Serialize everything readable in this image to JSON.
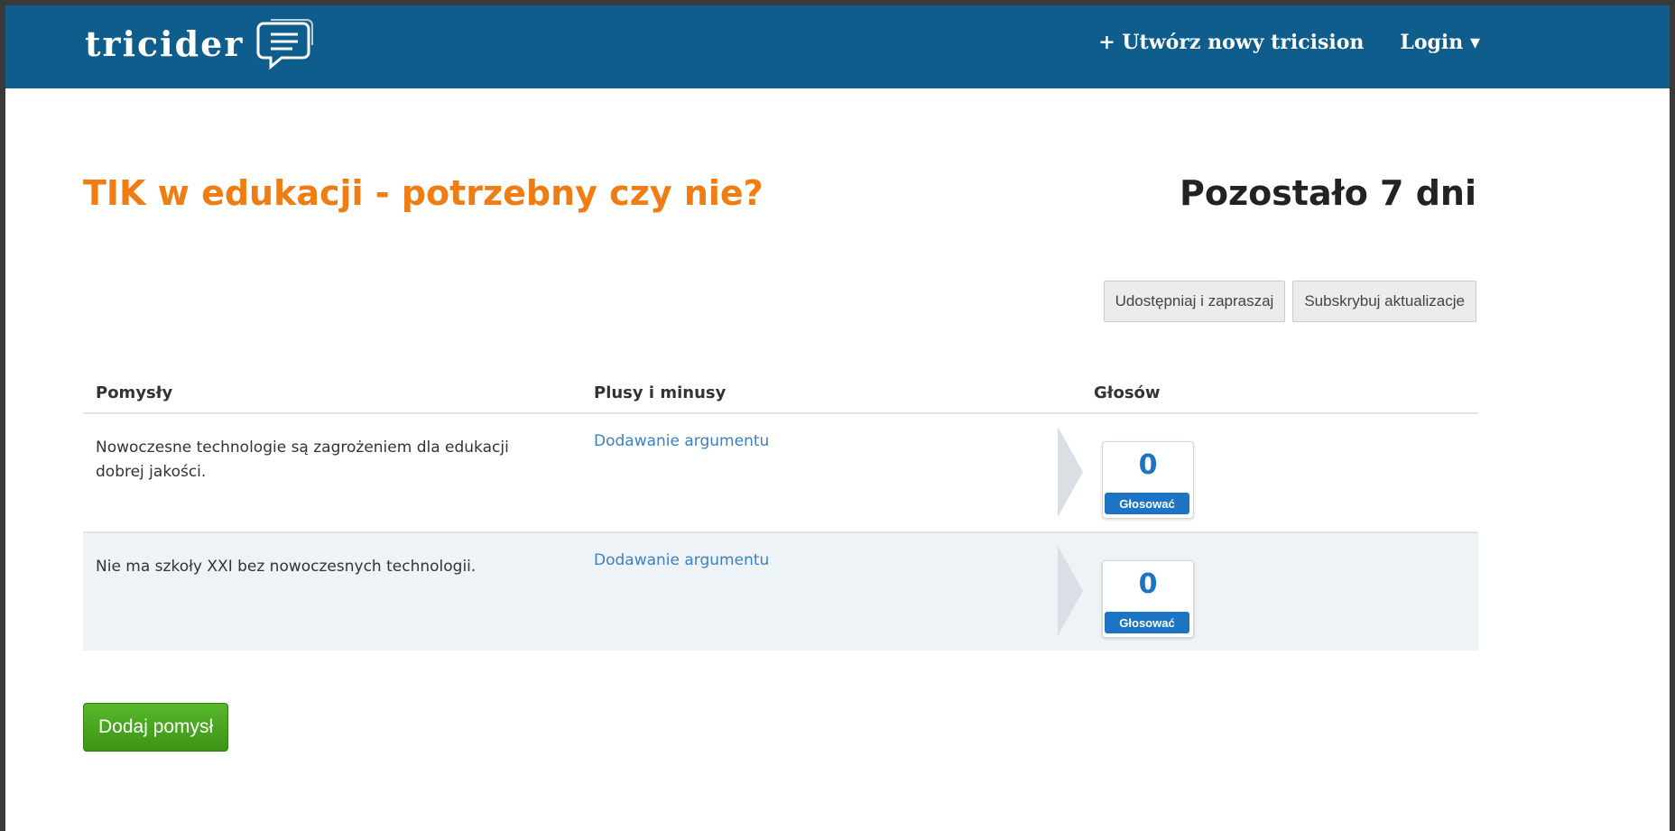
{
  "header": {
    "logo_text": "tricider",
    "nav": [
      {
        "label": "+ Utwórz nowy tricision"
      },
      {
        "label": "Login ▾"
      }
    ]
  },
  "page": {
    "title": "TIK w edukacji - potrzebny czy nie?",
    "remaining": "Pozostało 7 dni"
  },
  "actions": {
    "share_label": "Udostępniaj i zapraszaj",
    "subscribe_label": "Subskrybuj aktualizacje"
  },
  "table": {
    "headers": [
      "Pomysły",
      "Plusy i minusy",
      "Głosów"
    ],
    "rows": [
      {
        "idea": "Nowoczesne technologie są zagrożeniem dla edukacji dobrej jakości.",
        "argument_link": "Dodawanie argumentu",
        "votes": "0",
        "vote_label": "Głosować"
      },
      {
        "idea": "Nie ma szkoły XXI bez nowoczesnych technologii.",
        "argument_link": "Dodawanie argumentu",
        "votes": "0",
        "vote_label": "Głosować"
      }
    ]
  },
  "add_idea_label": "Dodaj pomysł",
  "colors": {
    "header_bg": "#0f5d8c",
    "title": "#f07d14",
    "link": "#3a82c4",
    "vote": "#1d74c2",
    "add_button": "#46a11d"
  },
  "icons": {
    "logo": "speech-bubble-list-icon",
    "row_arrow": "chevron-right-icon"
  }
}
